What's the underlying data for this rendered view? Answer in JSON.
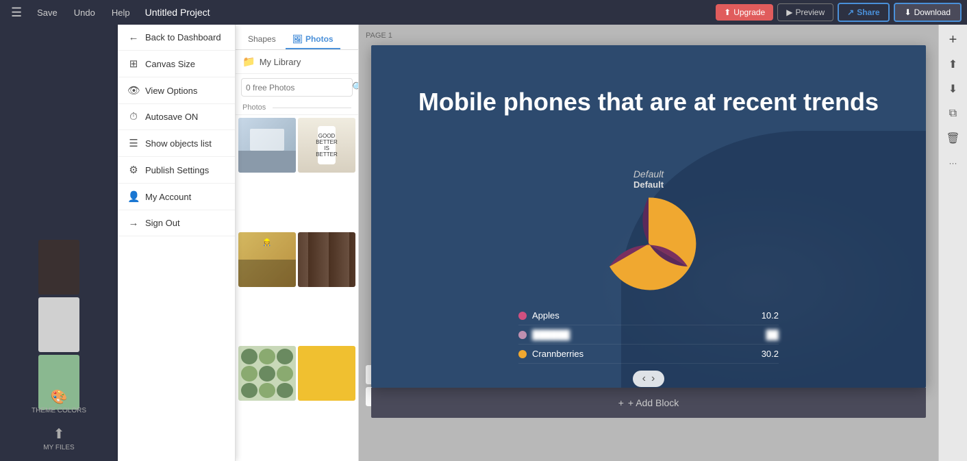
{
  "topbar": {
    "menu_icon": "☰",
    "save_label": "Save",
    "undo_label": "Undo",
    "help_label": "Help",
    "project_title": "Untitled Project",
    "upgrade_label": "Upgrade",
    "preview_label": "Preview",
    "share_label": "Share",
    "download_label": "Download"
  },
  "sidebar": {
    "items": [
      {
        "id": "back-to-dashboard",
        "icon": "←",
        "label": "Back to Dashboard"
      },
      {
        "id": "canvas-size",
        "icon": "⊞",
        "label": "Canvas Size"
      },
      {
        "id": "view-options",
        "icon": "👁",
        "label": "View Options"
      },
      {
        "id": "autosave",
        "icon": "⏱",
        "label": "Autosave ON"
      },
      {
        "id": "show-objects",
        "icon": "☰",
        "label": "Show objects list"
      },
      {
        "id": "publish-settings",
        "icon": "⚙",
        "label": "Publish Settings"
      },
      {
        "id": "my-account",
        "icon": "👤",
        "label": "My Account"
      },
      {
        "id": "sign-out",
        "icon": "→",
        "label": "Sign Out"
      }
    ],
    "tools": [
      {
        "id": "theme-colors",
        "icon": "🎨",
        "label": "THEME COLORS"
      },
      {
        "id": "my-files",
        "icon": "⬆",
        "label": "MY FILES"
      }
    ]
  },
  "photos_panel": {
    "tabs": [
      {
        "id": "shapes",
        "label": "Shapes",
        "active": false
      },
      {
        "id": "photos",
        "label": "Photos",
        "active": true,
        "icon": "🖼"
      }
    ],
    "my_library_label": "My Library",
    "search_placeholder": "0 free Photos",
    "section_label": "Photos",
    "photos": [
      {
        "id": "photo-1",
        "bg": "#a8b8c8",
        "desc": "office workspace"
      },
      {
        "id": "photo-2",
        "bg": "#d4c4a0",
        "desc": "white bottle text"
      },
      {
        "id": "photo-3",
        "bg": "#c8a060",
        "desc": "person drawing"
      },
      {
        "id": "photo-4",
        "bg": "#6a5a4a",
        "desc": "wood texture"
      },
      {
        "id": "photo-5",
        "bg": "#b8c8a8",
        "desc": "green pattern"
      },
      {
        "id": "photo-6",
        "bg": "#f0c040",
        "desc": "yellow item"
      }
    ]
  },
  "sidebar_thumbnails": [
    {
      "id": "thumb-1",
      "bg": "#2a2a2a",
      "desc": "dark photo coffee"
    },
    {
      "id": "thumb-2",
      "bg": "#d8d8d8",
      "desc": "glass item"
    },
    {
      "id": "thumb-3",
      "bg": "#a8c8a0",
      "desc": "green pattern"
    }
  ],
  "canvas": {
    "page_label": "PAGE 1",
    "slide": {
      "title": "Mobile phones that are at recent trends",
      "chart_label_italic": "Default",
      "chart_label_normal": "Default",
      "legend": [
        {
          "id": "apples",
          "color": "#d05080",
          "label": "Apples",
          "value": "10.2",
          "blurred": false
        },
        {
          "id": "item2",
          "color": "#c090b0",
          "label": "———",
          "value": "———",
          "blurred": true
        },
        {
          "id": "crannberries",
          "color": "#f0a830",
          "label": "Crannberries",
          "value": "30.2",
          "blurred": false
        }
      ]
    },
    "add_block_label": "+ Add Block",
    "zoom_controls": {
      "plus": "+",
      "minus": "−"
    }
  },
  "right_sidebar": {
    "buttons": [
      {
        "id": "add-btn",
        "icon": "+"
      },
      {
        "id": "align-v-btn",
        "icon": "⇕"
      },
      {
        "id": "align-h-btn",
        "icon": "⇔"
      },
      {
        "id": "copy-btn",
        "icon": "⧉"
      },
      {
        "id": "delete-btn",
        "icon": "🗑"
      },
      {
        "id": "more-btn",
        "icon": "···"
      }
    ]
  }
}
